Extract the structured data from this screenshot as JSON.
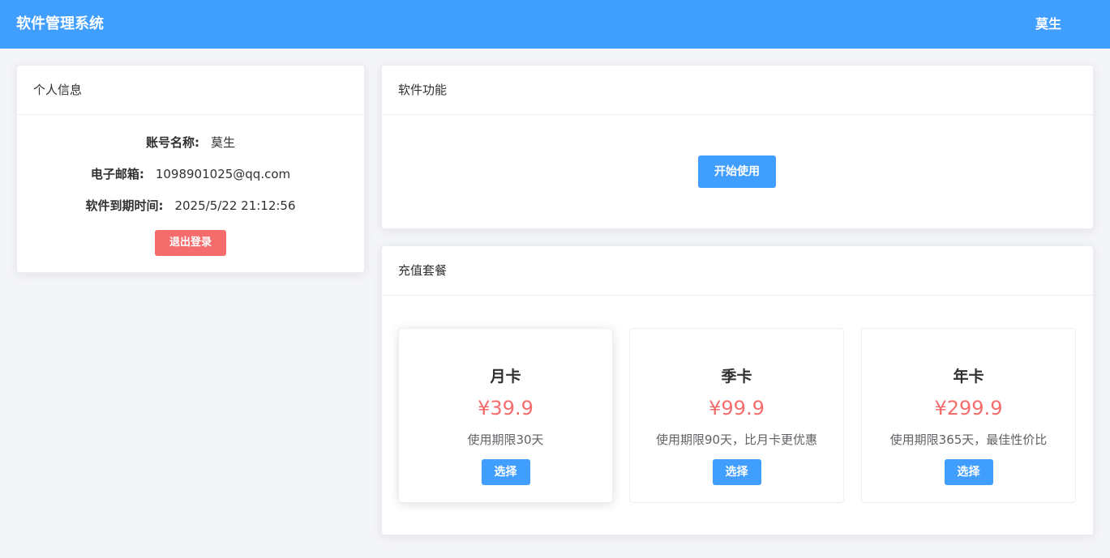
{
  "header": {
    "title": "软件管理系统",
    "user": "莫生"
  },
  "profile": {
    "title": "个人信息",
    "fields": [
      {
        "label": "账号名称:",
        "value": "莫生"
      },
      {
        "label": "电子邮箱:",
        "value": "1098901025@qq.com"
      },
      {
        "label": "软件到期时间:",
        "value": "2025/5/22 21:12:56"
      }
    ],
    "logout_label": "退出登录"
  },
  "features": {
    "title": "软件功能",
    "start_label": "开始使用"
  },
  "plans": {
    "title": "充值套餐",
    "items": [
      {
        "name": "月卡",
        "price": "¥39.9",
        "desc": "使用期限30天",
        "button": "选择"
      },
      {
        "name": "季卡",
        "price": "¥99.9",
        "desc": "使用期限90天，比月卡更优惠",
        "button": "选择"
      },
      {
        "name": "年卡",
        "price": "¥299.9",
        "desc": "使用期限365天，最佳性价比",
        "button": "选择"
      }
    ]
  },
  "colors": {
    "primary": "#409eff",
    "danger": "#f56c6c",
    "background": "#f4f5f8"
  }
}
